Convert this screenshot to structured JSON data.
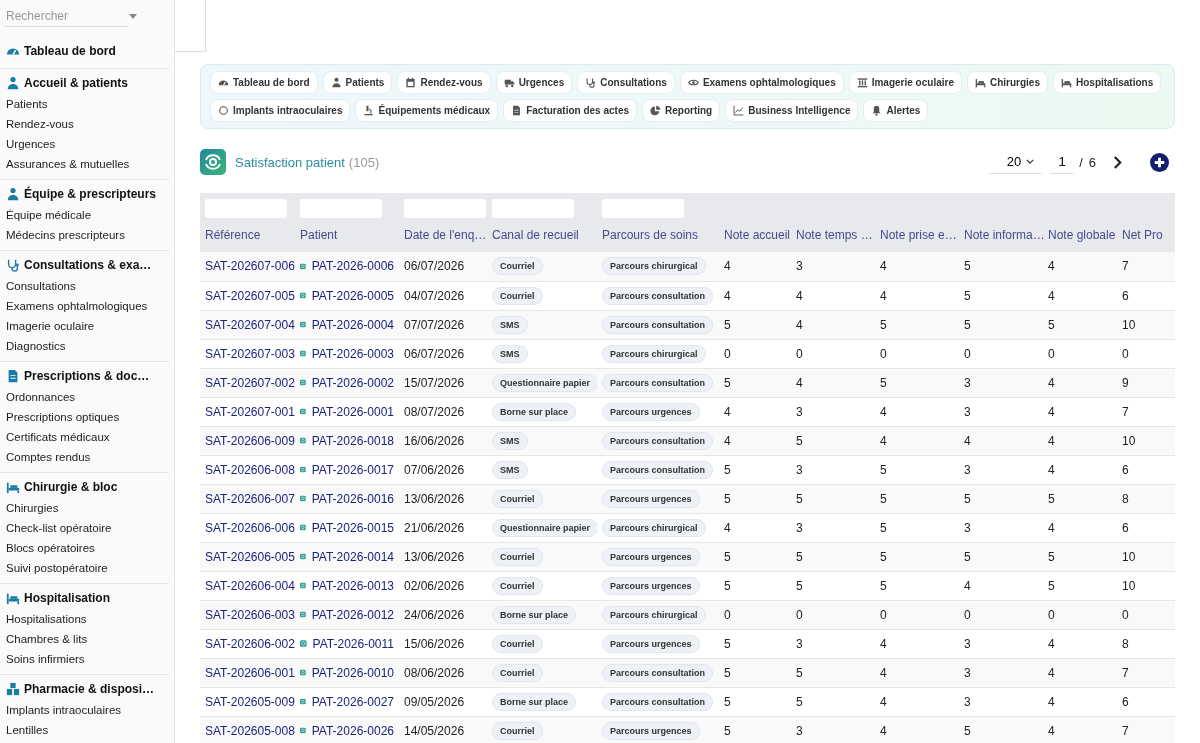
{
  "sidebar": {
    "search": {
      "placeholder": "Rechercher"
    },
    "sections": [
      {
        "title": "Tableau de bord"
      },
      {
        "title": "Accueil & patients",
        "items": [
          "Patients",
          "Rendez-vous",
          "Urgences",
          "Assurances & mutuelles"
        ]
      },
      {
        "title": "Équipe & prescripteurs",
        "items": [
          "Équipe médicale",
          "Médecins prescripteurs"
        ]
      },
      {
        "title": "Consultations & exa…",
        "items": [
          "Consultations",
          "Examens ophtalmologiques",
          "Imagerie oculaire",
          "Diagnostics"
        ]
      },
      {
        "title": "Prescriptions & doc…",
        "items": [
          "Ordonnances",
          "Prescriptions optiques",
          "Certificats médicaux",
          "Comptes rendus"
        ]
      },
      {
        "title": "Chirurgie & bloc",
        "items": [
          "Chirurgies",
          "Check-list opératoire",
          "Blocs opératoires",
          "Suivi postopératoire"
        ]
      },
      {
        "title": "Hospitalisation",
        "items": [
          "Hospitalisations",
          "Chambres & lits",
          "Soins infirmiers"
        ]
      },
      {
        "title": "Pharmacie & disposi…",
        "items": [
          "Implants intraoculaires",
          "Lentilles"
        ]
      }
    ]
  },
  "shortcuts": [
    "Tableau de bord",
    "Patients",
    "Rendez-vous",
    "Urgences",
    "Consultations",
    "Examens ophtalmologiques",
    "Imagerie oculaire",
    "Chirurgies",
    "Hospitalisations",
    "Implants intraoculaires",
    "Équipements médicaux",
    "Facturation des actes",
    "Reporting",
    "Business Intelligence",
    "Alertes"
  ],
  "list": {
    "title": "Satisfaction patient",
    "count": "(105)",
    "page_size": "20",
    "page": "1",
    "page_separator": "/",
    "total_pages": "6"
  },
  "table": {
    "columns": [
      "Référence",
      "Patient",
      "Date de l'enq…",
      "Canal de recueil",
      "Parcours de soins",
      "Note accueil",
      "Note temps …",
      "Note prise e…",
      "Note informa…",
      "Note globale",
      "Net Pro"
    ],
    "rows": [
      {
        "reference": "SAT-202607-006",
        "patient": "PAT-2026-0006",
        "date": "06/07/2026",
        "canal": "Courriel",
        "parcours": "Parcours chirurgical",
        "notes": [
          "4",
          "3",
          "4",
          "5",
          "4",
          "7"
        ]
      },
      {
        "reference": "SAT-202607-005",
        "patient": "PAT-2026-0005",
        "date": "04/07/2026",
        "canal": "Courriel",
        "parcours": "Parcours consultation",
        "notes": [
          "4",
          "4",
          "4",
          "5",
          "4",
          "6"
        ]
      },
      {
        "reference": "SAT-202607-004",
        "patient": "PAT-2026-0004",
        "date": "07/07/2026",
        "canal": "SMS",
        "parcours": "Parcours consultation",
        "notes": [
          "5",
          "4",
          "5",
          "5",
          "5",
          "10"
        ]
      },
      {
        "reference": "SAT-202607-003",
        "patient": "PAT-2026-0003",
        "date": "06/07/2026",
        "canal": "SMS",
        "parcours": "Parcours chirurgical",
        "notes": [
          "0",
          "0",
          "0",
          "0",
          "0",
          "0"
        ]
      },
      {
        "reference": "SAT-202607-002",
        "patient": "PAT-2026-0002",
        "date": "15/07/2026",
        "canal": "Questionnaire papier",
        "parcours": "Parcours consultation",
        "notes": [
          "5",
          "4",
          "5",
          "3",
          "4",
          "9"
        ]
      },
      {
        "reference": "SAT-202607-001",
        "patient": "PAT-2026-0001",
        "date": "08/07/2026",
        "canal": "Borne sur place",
        "parcours": "Parcours urgences",
        "notes": [
          "4",
          "3",
          "4",
          "3",
          "4",
          "7"
        ]
      },
      {
        "reference": "SAT-202606-009",
        "patient": "PAT-2026-0018",
        "date": "16/06/2026",
        "canal": "SMS",
        "parcours": "Parcours consultation",
        "notes": [
          "4",
          "5",
          "4",
          "4",
          "4",
          "10"
        ]
      },
      {
        "reference": "SAT-202606-008",
        "patient": "PAT-2026-0017",
        "date": "07/06/2026",
        "canal": "SMS",
        "parcours": "Parcours consultation",
        "notes": [
          "5",
          "3",
          "5",
          "3",
          "4",
          "6"
        ]
      },
      {
        "reference": "SAT-202606-007",
        "patient": "PAT-2026-0016",
        "date": "13/06/2026",
        "canal": "Courriel",
        "parcours": "Parcours urgences",
        "notes": [
          "5",
          "5",
          "5",
          "5",
          "5",
          "8"
        ]
      },
      {
        "reference": "SAT-202606-006",
        "patient": "PAT-2026-0015",
        "date": "21/06/2026",
        "canal": "Questionnaire papier",
        "parcours": "Parcours chirurgical",
        "notes": [
          "4",
          "3",
          "5",
          "3",
          "4",
          "6"
        ]
      },
      {
        "reference": "SAT-202606-005",
        "patient": "PAT-2026-0014",
        "date": "13/06/2026",
        "canal": "Courriel",
        "parcours": "Parcours urgences",
        "notes": [
          "5",
          "5",
          "5",
          "5",
          "5",
          "10"
        ]
      },
      {
        "reference": "SAT-202606-004",
        "patient": "PAT-2026-0013",
        "date": "02/06/2026",
        "canal": "Courriel",
        "parcours": "Parcours urgences",
        "notes": [
          "5",
          "5",
          "5",
          "4",
          "5",
          "10"
        ]
      },
      {
        "reference": "SAT-202606-003",
        "patient": "PAT-2026-0012",
        "date": "24/06/2026",
        "canal": "Borne sur place",
        "parcours": "Parcours chirurgical",
        "notes": [
          "0",
          "0",
          "0",
          "0",
          "0",
          "0"
        ]
      },
      {
        "reference": "SAT-202606-002",
        "patient": "PAT-2026-0011",
        "date": "15/06/2026",
        "canal": "Courriel",
        "parcours": "Parcours urgences",
        "notes": [
          "5",
          "3",
          "4",
          "3",
          "4",
          "8"
        ]
      },
      {
        "reference": "SAT-202606-001",
        "patient": "PAT-2026-0010",
        "date": "08/06/2026",
        "canal": "Courriel",
        "parcours": "Parcours consultation",
        "notes": [
          "5",
          "5",
          "4",
          "3",
          "4",
          "7"
        ]
      },
      {
        "reference": "SAT-202605-009",
        "patient": "PAT-2026-0027",
        "date": "09/05/2026",
        "canal": "Borne sur place",
        "parcours": "Parcours consultation",
        "notes": [
          "5",
          "5",
          "4",
          "3",
          "4",
          "6"
        ]
      },
      {
        "reference": "SAT-202605-008",
        "patient": "PAT-2026-0026",
        "date": "14/05/2026",
        "canal": "Courriel",
        "parcours": "Parcours urgences",
        "notes": [
          "5",
          "3",
          "4",
          "5",
          "4",
          "7"
        ]
      }
    ]
  }
}
